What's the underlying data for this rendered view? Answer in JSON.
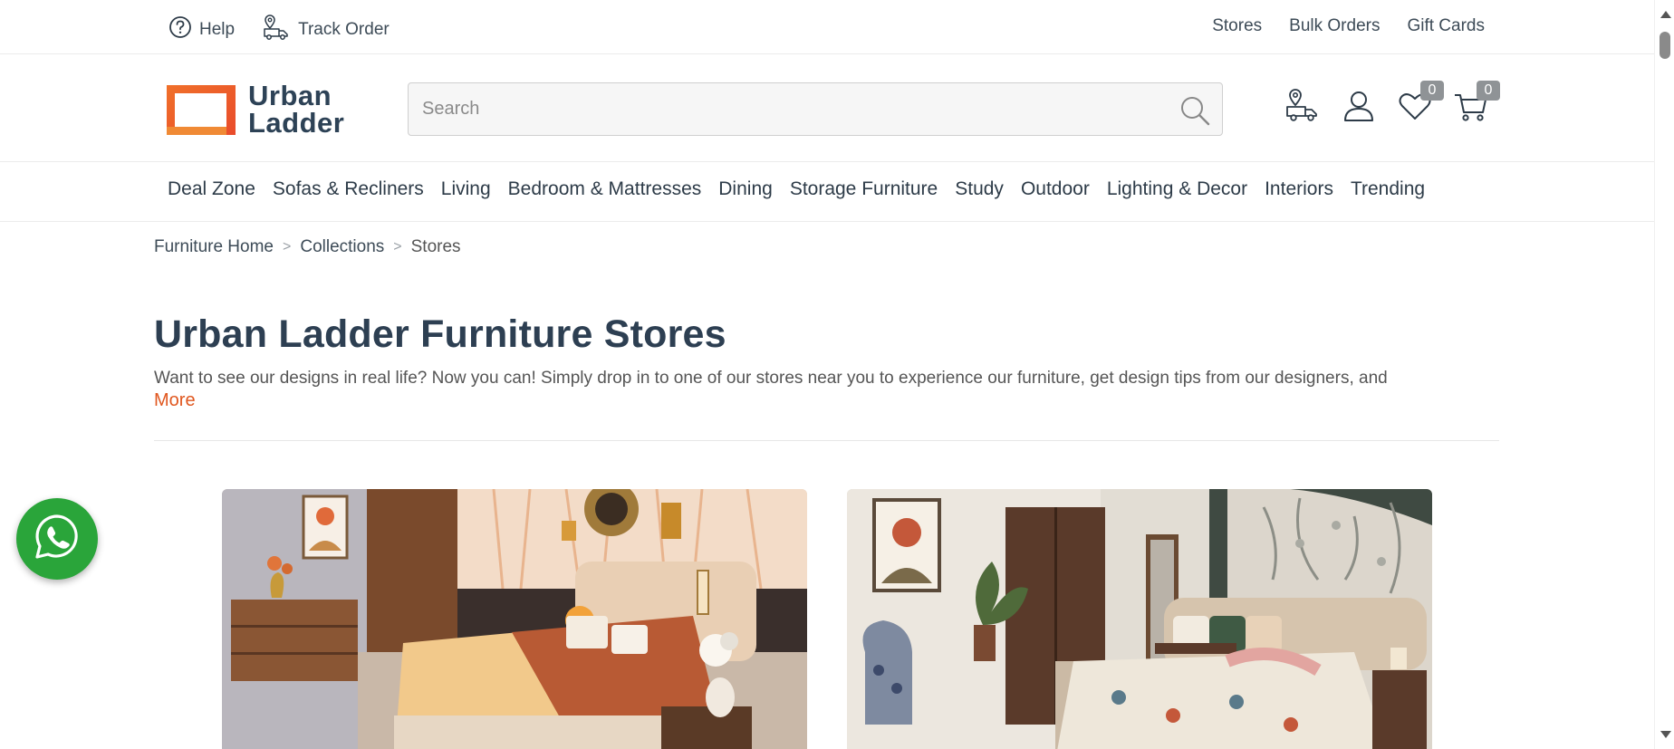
{
  "topbar": {
    "help_label": "Help",
    "track_order_label": "Track Order",
    "right_links": [
      "Stores",
      "Bulk Orders",
      "Gift Cards"
    ]
  },
  "header": {
    "logo_line1": "Urban",
    "logo_line2": "Ladder",
    "search_placeholder": "Search",
    "wishlist_count": "0",
    "cart_count": "0"
  },
  "category_nav": [
    "Deal Zone",
    "Sofas & Recliners",
    "Living",
    "Bedroom & Mattresses",
    "Dining",
    "Storage Furniture",
    "Study",
    "Outdoor",
    "Lighting & Decor",
    "Interiors",
    "Trending"
  ],
  "breadcrumb": {
    "items": [
      "Furniture Home",
      "Collections",
      "Stores"
    ],
    "separator": ">"
  },
  "main": {
    "title": "Urban Ladder Furniture Stores",
    "description": "Want to see our designs in real life? Now you can! Simply drop in to one of our stores near you to experience our furniture, get design tips from our designers, and",
    "more_label": "More"
  },
  "colors": {
    "brand_orange": "#e0571f",
    "brand_navy": "#2d4256",
    "whatsapp_green": "#2aa53a"
  },
  "icons": {
    "help": "help-circle-icon",
    "track_order": "delivery-truck-icon",
    "search": "search-icon",
    "store_locator": "store-locator-truck-icon",
    "account": "user-icon",
    "wishlist": "heart-icon",
    "cart": "cart-icon",
    "whatsapp": "whatsapp-icon"
  }
}
